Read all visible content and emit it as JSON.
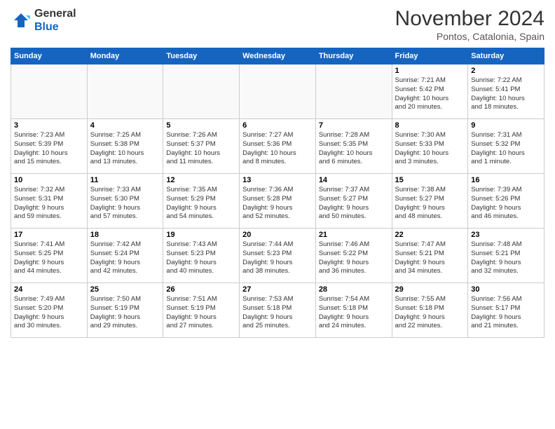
{
  "header": {
    "logo_general": "General",
    "logo_blue": "Blue",
    "month_title": "November 2024",
    "location": "Pontos, Catalonia, Spain"
  },
  "weekdays": [
    "Sunday",
    "Monday",
    "Tuesday",
    "Wednesday",
    "Thursday",
    "Friday",
    "Saturday"
  ],
  "weeks": [
    [
      {
        "day": "",
        "info": ""
      },
      {
        "day": "",
        "info": ""
      },
      {
        "day": "",
        "info": ""
      },
      {
        "day": "",
        "info": ""
      },
      {
        "day": "",
        "info": ""
      },
      {
        "day": "1",
        "info": "Sunrise: 7:21 AM\nSunset: 5:42 PM\nDaylight: 10 hours\nand 20 minutes."
      },
      {
        "day": "2",
        "info": "Sunrise: 7:22 AM\nSunset: 5:41 PM\nDaylight: 10 hours\nand 18 minutes."
      }
    ],
    [
      {
        "day": "3",
        "info": "Sunrise: 7:23 AM\nSunset: 5:39 PM\nDaylight: 10 hours\nand 15 minutes."
      },
      {
        "day": "4",
        "info": "Sunrise: 7:25 AM\nSunset: 5:38 PM\nDaylight: 10 hours\nand 13 minutes."
      },
      {
        "day": "5",
        "info": "Sunrise: 7:26 AM\nSunset: 5:37 PM\nDaylight: 10 hours\nand 11 minutes."
      },
      {
        "day": "6",
        "info": "Sunrise: 7:27 AM\nSunset: 5:36 PM\nDaylight: 10 hours\nand 8 minutes."
      },
      {
        "day": "7",
        "info": "Sunrise: 7:28 AM\nSunset: 5:35 PM\nDaylight: 10 hours\nand 6 minutes."
      },
      {
        "day": "8",
        "info": "Sunrise: 7:30 AM\nSunset: 5:33 PM\nDaylight: 10 hours\nand 3 minutes."
      },
      {
        "day": "9",
        "info": "Sunrise: 7:31 AM\nSunset: 5:32 PM\nDaylight: 10 hours\nand 1 minute."
      }
    ],
    [
      {
        "day": "10",
        "info": "Sunrise: 7:32 AM\nSunset: 5:31 PM\nDaylight: 9 hours\nand 59 minutes."
      },
      {
        "day": "11",
        "info": "Sunrise: 7:33 AM\nSunset: 5:30 PM\nDaylight: 9 hours\nand 57 minutes."
      },
      {
        "day": "12",
        "info": "Sunrise: 7:35 AM\nSunset: 5:29 PM\nDaylight: 9 hours\nand 54 minutes."
      },
      {
        "day": "13",
        "info": "Sunrise: 7:36 AM\nSunset: 5:28 PM\nDaylight: 9 hours\nand 52 minutes."
      },
      {
        "day": "14",
        "info": "Sunrise: 7:37 AM\nSunset: 5:27 PM\nDaylight: 9 hours\nand 50 minutes."
      },
      {
        "day": "15",
        "info": "Sunrise: 7:38 AM\nSunset: 5:27 PM\nDaylight: 9 hours\nand 48 minutes."
      },
      {
        "day": "16",
        "info": "Sunrise: 7:39 AM\nSunset: 5:26 PM\nDaylight: 9 hours\nand 46 minutes."
      }
    ],
    [
      {
        "day": "17",
        "info": "Sunrise: 7:41 AM\nSunset: 5:25 PM\nDaylight: 9 hours\nand 44 minutes."
      },
      {
        "day": "18",
        "info": "Sunrise: 7:42 AM\nSunset: 5:24 PM\nDaylight: 9 hours\nand 42 minutes."
      },
      {
        "day": "19",
        "info": "Sunrise: 7:43 AM\nSunset: 5:23 PM\nDaylight: 9 hours\nand 40 minutes."
      },
      {
        "day": "20",
        "info": "Sunrise: 7:44 AM\nSunset: 5:23 PM\nDaylight: 9 hours\nand 38 minutes."
      },
      {
        "day": "21",
        "info": "Sunrise: 7:46 AM\nSunset: 5:22 PM\nDaylight: 9 hours\nand 36 minutes."
      },
      {
        "day": "22",
        "info": "Sunrise: 7:47 AM\nSunset: 5:21 PM\nDaylight: 9 hours\nand 34 minutes."
      },
      {
        "day": "23",
        "info": "Sunrise: 7:48 AM\nSunset: 5:21 PM\nDaylight: 9 hours\nand 32 minutes."
      }
    ],
    [
      {
        "day": "24",
        "info": "Sunrise: 7:49 AM\nSunset: 5:20 PM\nDaylight: 9 hours\nand 30 minutes."
      },
      {
        "day": "25",
        "info": "Sunrise: 7:50 AM\nSunset: 5:19 PM\nDaylight: 9 hours\nand 29 minutes."
      },
      {
        "day": "26",
        "info": "Sunrise: 7:51 AM\nSunset: 5:19 PM\nDaylight: 9 hours\nand 27 minutes."
      },
      {
        "day": "27",
        "info": "Sunrise: 7:53 AM\nSunset: 5:18 PM\nDaylight: 9 hours\nand 25 minutes."
      },
      {
        "day": "28",
        "info": "Sunrise: 7:54 AM\nSunset: 5:18 PM\nDaylight: 9 hours\nand 24 minutes."
      },
      {
        "day": "29",
        "info": "Sunrise: 7:55 AM\nSunset: 5:18 PM\nDaylight: 9 hours\nand 22 minutes."
      },
      {
        "day": "30",
        "info": "Sunrise: 7:56 AM\nSunset: 5:17 PM\nDaylight: 9 hours\nand 21 minutes."
      }
    ]
  ]
}
